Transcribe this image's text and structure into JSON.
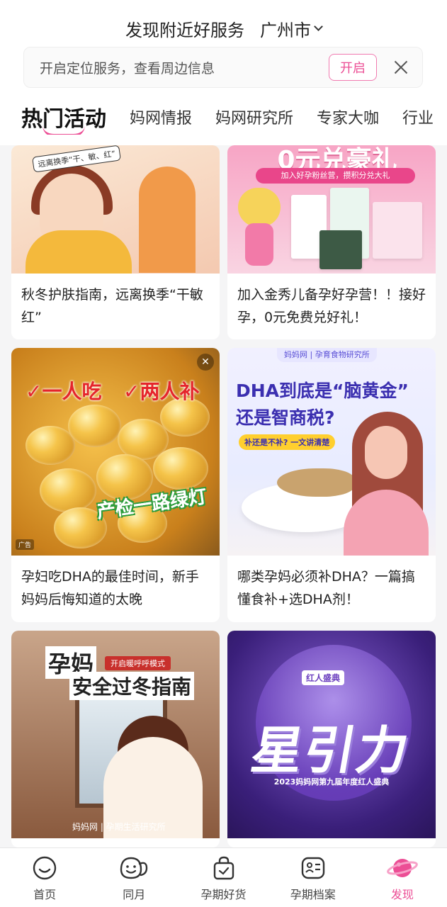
{
  "header": {
    "title": "发现附近好服务",
    "city": "广州市",
    "location_bar": {
      "text": "开启定位服务，查看周边信息",
      "enable_label": "开启"
    }
  },
  "tabs": [
    {
      "label": "热门活动",
      "active": true
    },
    {
      "label": "妈网情报",
      "active": false
    },
    {
      "label": "妈网研究所",
      "active": false
    },
    {
      "label": "专家大咖",
      "active": false
    },
    {
      "label": "行业",
      "active": false
    }
  ],
  "cards": [
    {
      "caption": "秋冬护肤指南，远离换季“干敏红”",
      "image_text": {
        "tag": "远离换季“干、敏、红”"
      }
    },
    {
      "caption": "加入金秀儿备孕好孕营！！接好孕，0元免费兑好礼！",
      "image_text": {
        "headline": "0元兑豪礼",
        "sub": "加入好孕粉丝营，攒积分兑大礼"
      }
    },
    {
      "caption": "孕妇吃DHA的最佳时间，新手妈妈后悔知道的太晚",
      "image_text": {
        "left": "✓一人吃",
        "right": "✓两人补",
        "bottom": "产检一路绿灯",
        "ad": "广告",
        "close": "✕"
      }
    },
    {
      "caption": "哪类孕妈必须补DHA？一篇搞懂食补+选DHA剂！",
      "image_text": {
        "brand": "妈妈网 | 孕育食物研究所",
        "line1": "DHA到底是“脑黄金”",
        "line2": "还是智商税?",
        "pill": "补还是不补? 一文讲清楚"
      }
    },
    {
      "caption": "",
      "image_text": {
        "title1": "孕妈",
        "tag": "开启暖呼呼模式",
        "title2": "安全过冬指南",
        "brand": "妈妈网 | 孕期生活研究所"
      }
    },
    {
      "caption": "",
      "image_text": {
        "badge": "红人盛典",
        "big": "星引力",
        "sub": "2023妈妈网第九届年度红人盛典"
      }
    }
  ],
  "bottom_nav": [
    {
      "label": "首页",
      "icon": "smile-face-icon",
      "active": false
    },
    {
      "label": "同月",
      "icon": "group-face-icon",
      "active": false
    },
    {
      "label": "孕期好货",
      "icon": "shopping-bag-icon",
      "active": false
    },
    {
      "label": "孕期档案",
      "icon": "profile-card-icon",
      "active": false
    },
    {
      "label": "发现",
      "icon": "planet-icon",
      "active": true
    }
  ],
  "colors": {
    "accent": "#ec4e95",
    "background": "#f5f5f6"
  }
}
